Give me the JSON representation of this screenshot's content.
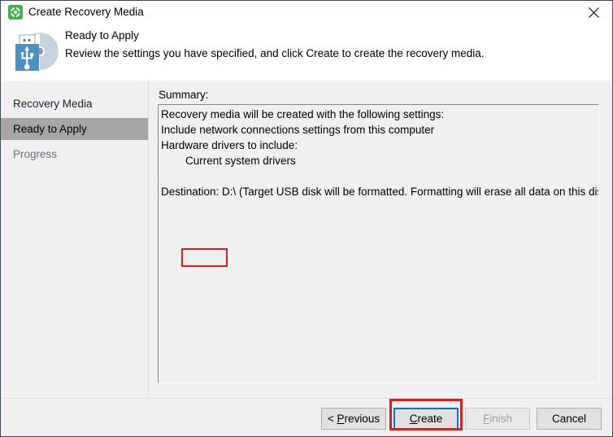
{
  "window": {
    "title": "Create Recovery Media",
    "app_icon": "recovery-lifebuoy-icon",
    "close_label": "Close"
  },
  "header": {
    "icon": "usb-disc-media-icon",
    "title": "Ready to Apply",
    "subtitle": "Review the settings you have specified, and click Create to create the recovery media."
  },
  "sidebar": {
    "items": [
      {
        "label": "Recovery Media",
        "state": "normal"
      },
      {
        "label": "Ready to Apply",
        "state": "selected"
      },
      {
        "label": "Progress",
        "state": "muted"
      }
    ]
  },
  "main": {
    "summary_label": "Summary:",
    "summary_lines": [
      "Recovery media will be created with the following settings:",
      "Include network connections settings from this computer",
      "Hardware drivers to include:",
      "        Current system drivers",
      "",
      "Destination: D:\\ (Target USB disk will be formatted. Formatting will erase all data on this disk.)"
    ],
    "summary_text": "Recovery media will be created with the following settings:\nInclude network connections settings from this computer\nHardware drivers to include:\n        Current system drivers\n\nDestination: D:\\ (Target USB disk will be formatted. Formatting will erase all data on this disk.)"
  },
  "annotations": {
    "destination_highlight": "Destination: D:\\",
    "create_highlight": "Create",
    "color": "#e8191b"
  },
  "footer": {
    "buttons": [
      {
        "name": "previous",
        "prefix": "< ",
        "accel": "P",
        "rest": "revious",
        "enabled": true
      },
      {
        "name": "create",
        "prefix": "",
        "accel": "C",
        "rest": "reate",
        "enabled": true,
        "focused": true
      },
      {
        "name": "finish",
        "prefix": "",
        "accel": "F",
        "rest": "inish",
        "enabled": false
      },
      {
        "name": "cancel",
        "prefix": "",
        "accel": "",
        "rest": "Cancel",
        "enabled": true
      }
    ]
  },
  "colors": {
    "window_border": "#3c4a59",
    "body_background": "#f0f0f0",
    "selection": "#a6a6a6",
    "focus_blue": "#0078d7",
    "annotation_red": "#e8191b",
    "app_icon_green": "#3bb44a",
    "usb_blue": "#4a90c4"
  }
}
